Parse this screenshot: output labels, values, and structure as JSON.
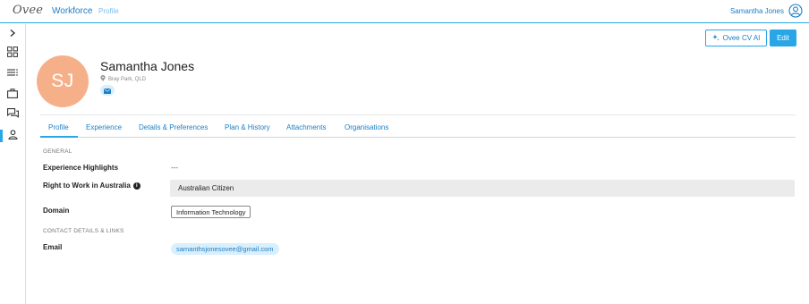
{
  "topbar": {
    "logo": "Ovee",
    "nav_workforce": "Workforce",
    "nav_profile": "Profile",
    "user_name": "Samantha Jones",
    "user_icon": "user-circle-icon"
  },
  "sidebar": {
    "items": [
      {
        "icon": "chevron-right-icon"
      },
      {
        "icon": "dashboard-grid-icon"
      },
      {
        "icon": "list-icon"
      },
      {
        "icon": "briefcase-icon"
      },
      {
        "icon": "chat-icon"
      },
      {
        "icon": "person-icon",
        "active": true
      }
    ]
  },
  "actions": {
    "cv_ai_label": "Ovee CV AI",
    "cv_ai_icon": "sparkle-icon",
    "edit_label": "Edit"
  },
  "profile": {
    "initials": "SJ",
    "avatar_color": "#f6b089",
    "name": "Samantha Jones",
    "location": "Bray Park, QLD",
    "location_icon": "location-pin-icon",
    "mail_icon": "mail-icon"
  },
  "tabs": [
    {
      "label": "Profile",
      "active": true
    },
    {
      "label": "Experience"
    },
    {
      "label": "Details & Preferences"
    },
    {
      "label": "Plan & History"
    },
    {
      "label": "Attachments"
    },
    {
      "label": "Organisations"
    }
  ],
  "general": {
    "title": "GENERAL",
    "experience_label": "Experience Highlights",
    "experience_value": "---",
    "right_to_work_label": "Right to Work in Australia",
    "right_to_work_value": "Australian Citizen",
    "domain_label": "Domain",
    "domain_value": "Information Technology"
  },
  "contact": {
    "title": "CONTACT DETAILS & LINKS",
    "email_label": "Email",
    "email_value": "samanthsjonesovee@gmail.com"
  },
  "colors": {
    "accent": "#2aa6e6",
    "link": "#1c7fc4",
    "chip_bg": "#d9effb"
  }
}
